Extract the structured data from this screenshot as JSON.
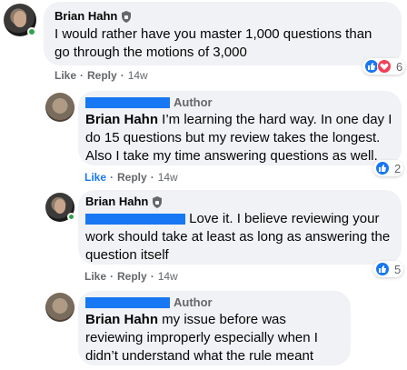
{
  "comments": [
    {
      "author": "Brian Hahn",
      "text": "I would rather have you master 1,000 questions than go through the motions of 3,000",
      "actions": {
        "like": "Like",
        "reply": "Reply",
        "time": "14w"
      },
      "reactions": {
        "count": "6",
        "types": [
          "like-icon",
          "love-icon"
        ]
      }
    },
    {
      "tag": "Author",
      "mention": "Brian Hahn",
      "text": " I’m learning the hard way. In one day I do 15 questions but my review takes the longest. Also I take my time answering questions as well.",
      "actions": {
        "like": "Like",
        "reply": "Reply",
        "time": "14w"
      },
      "reactions": {
        "count": "2",
        "types": [
          "like-icon"
        ]
      }
    },
    {
      "author": "Brian Hahn",
      "text": " Love it. I believe reviewing your work should take at least as long as answering the question itself",
      "actions": {
        "like": "Like",
        "reply": "Reply",
        "time": "14w"
      },
      "reactions": {
        "count": "5",
        "types": [
          "like-icon"
        ]
      }
    },
    {
      "tag": "Author",
      "mention": "Brian Hahn",
      "text": " my issue before was reviewing improperly especially when I didn’t understand what the rule meant"
    }
  ],
  "separator": "·",
  "colors": {
    "bubble": "#f0f2f5",
    "redaction": "#1877f2",
    "meta": "#65676b",
    "like": "#1877f2",
    "love": "#f33e58",
    "online": "#31a24c"
  }
}
